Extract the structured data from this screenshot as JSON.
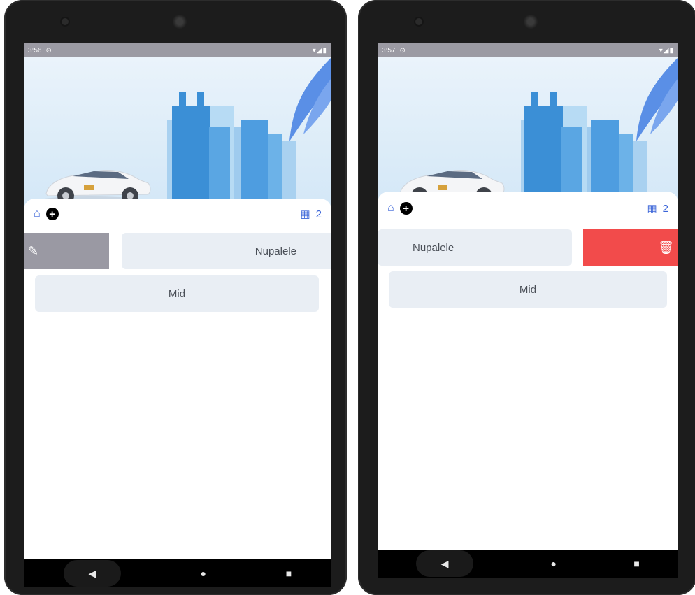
{
  "left": {
    "status_time": "3:56",
    "status_icons": "▾◢▮",
    "count": "2",
    "swiped_item_label": "Nupalele",
    "second_item_label": "Mid",
    "swipe_action": "edit-icon"
  },
  "right": {
    "status_time": "3:57",
    "status_icons": "▾◢▮",
    "count": "2",
    "swiped_item_label": "Nupalele",
    "second_item_label": "Mid",
    "swipe_action": "trash-icon"
  },
  "colors": {
    "accent": "#3a64d8",
    "edit_action": "#9a99a3",
    "delete_action": "#f24b4b",
    "tile_bg": "#e9eef4"
  },
  "nav": {
    "back": "◀",
    "home": "●",
    "recent": "■"
  }
}
